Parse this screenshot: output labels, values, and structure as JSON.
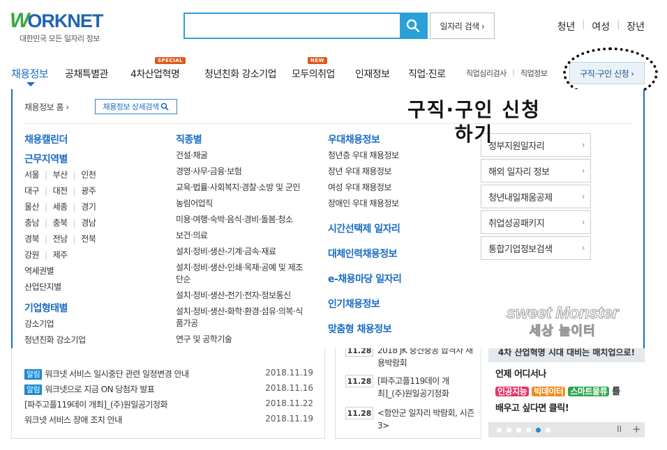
{
  "header": {
    "logo_text": "WORKNET",
    "logo_sub": "대한민국 모든 일자리 정보",
    "search_placeholder": "",
    "job_search_label": "일자리 검색 ›",
    "top_links": [
      "청년",
      "여성",
      "장년"
    ]
  },
  "gnb": {
    "items": [
      "채용정보",
      "공채특별관",
      "4차산업혁명",
      "청년친화 강소기업",
      "모두의취업",
      "인재정보",
      "직업·진로"
    ],
    "badges": {
      "special": "SPECIAL",
      "new": "NEW"
    },
    "small_links": [
      "직업심리검사",
      "직업정보"
    ],
    "apply_label": "구직·구인 신청 ›"
  },
  "panel": {
    "home": "채용정보 홈 ›",
    "detail_search": "채용정보 상세검색",
    "col1": {
      "calendar": "채용캘린더",
      "region_head": "근무지역별",
      "regions": [
        [
          "서울",
          "부산",
          "인천"
        ],
        [
          "대구",
          "대전",
          "광주"
        ],
        [
          "울산",
          "세종",
          "경기"
        ],
        [
          "충남",
          "충북",
          "경남"
        ],
        [
          "경북",
          "전남",
          "전북"
        ],
        [
          "강원",
          "제주"
        ]
      ],
      "station": "역세권별",
      "industrial": "산업단지별",
      "company_head": "기업형태별",
      "company_items": [
        "강소기업",
        "청년친화 강소기업"
      ]
    },
    "col2": {
      "head": "직종별",
      "items": [
        "건설·채굴",
        "경영·사무·금융·보험",
        "교육·법률·사회복지·경찰·소방 및 군인",
        "농림어업직",
        "미용·여행·숙박·음식·경비·돌봄·청소",
        "보건·의료",
        "설치·정비·생산-기계·금속·재료",
        "설치·정비·생산-인쇄·목재·공예 및 제조 단순",
        "설치·정비·생산-전기·전자·정보통신",
        "설치·정비·생산-화학·환경·섬유·의복·식품가공",
        "연구 및 공학기술"
      ]
    },
    "col3": {
      "head": "우대채용정보",
      "items": [
        "청년층 우대 채용정보",
        "장년 우대 채용정보",
        "여성 우대 채용정보",
        "장애인 우대 채용정보"
      ],
      "heads2": [
        "시간선택제 일자리",
        "대체인력채용정보",
        "e-채용마당 일자리",
        "인기채용정보",
        "맞춤형 채용정보"
      ]
    },
    "side_buttons": [
      "정부지원일자리",
      "해외 일자리 정보",
      "청년내일채움공제",
      "취업성공패키지",
      "통합기업정보검색"
    ]
  },
  "overlay": {
    "caption": "구직·구인 신청 하기",
    "watermark_1": "sweet Monster",
    "watermark_2": "세상 놀이터"
  },
  "notices": [
    {
      "tag": "알림",
      "text": "워크넷 서비스 일시중단 관련 일정변경 안내",
      "date": "2018.11.19"
    },
    {
      "tag": "알림",
      "text": "워크넷으로 지금 ON 당첨자 발표",
      "date": "2018.11.16"
    },
    {
      "tag": "",
      "text": "[파주고플119데이 개최]_(주)원일공기정화",
      "date": "2018.11.22"
    },
    {
      "tag": "",
      "text": "워크넷 서비스 장애 조치 안내",
      "date": "2018.11.19"
    }
  ],
  "events": [
    {
      "date": "11.28",
      "text": "2018 JK 중견중공 합격자 채용박람회"
    },
    {
      "date": "11.28",
      "text": "[파주고플119데이 개최]_(주)원일공기정화"
    },
    {
      "date": "11.28",
      "text": "<함안군 일자리 박람회, 시즌3>"
    }
  ],
  "promo": {
    "top": "4차 산업혁명 시대 대비는 매치업으로!",
    "line1": "언제 어디서나",
    "pills": [
      "인공지능",
      "빅데이터",
      "스마트물류"
    ],
    "pill_suffix": "를",
    "line3": "배우고 싶다면 클릭!",
    "pause": "II",
    "plus": "+"
  },
  "colors": {
    "accent": "#1b6cc2",
    "search": "#2aa0d8"
  }
}
